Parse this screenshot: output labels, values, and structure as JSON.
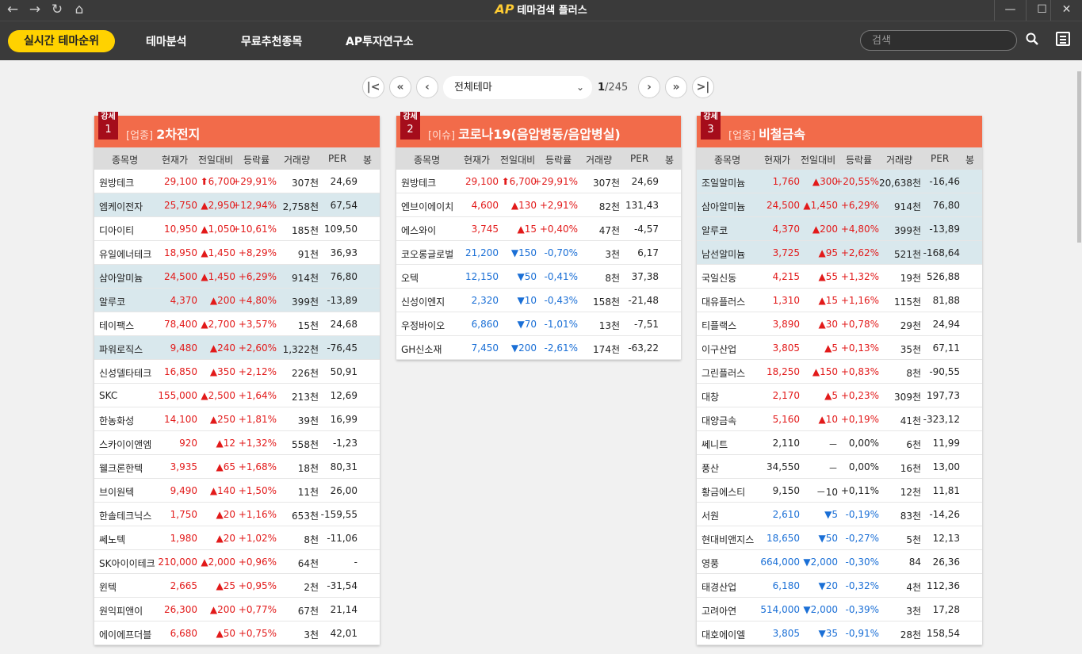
{
  "app": {
    "title": "테마검색 플러스",
    "logo": "AP"
  },
  "nav_icons": [
    "back-icon",
    "forward-icon",
    "refresh-icon",
    "home-icon"
  ],
  "window_controls": [
    "minimize-icon",
    "maximize-icon",
    "close-icon"
  ],
  "menu": {
    "active": "실시간 테마순위",
    "items": [
      "테마분석",
      "무료추천종목",
      "AP투자연구소"
    ],
    "search_placeholder": "검색"
  },
  "pager": {
    "select": "전체테마",
    "current": "1",
    "total": "/245"
  },
  "columns": [
    "종목명",
    "현재가",
    "전일대비",
    "등락률",
    "거래량",
    "PER",
    "봉"
  ],
  "colors": {
    "up": "#e21a1a",
    "down": "#1a6fd6",
    "header": "#f26b4a",
    "badge": "#a50d1b",
    "highlight": "#d9e8ed"
  },
  "panels": [
    {
      "strength": "강세",
      "rank": "1",
      "category": "[업종]",
      "name": "2차전지",
      "rows": [
        {
          "name": "원방테크",
          "price": "29,100",
          "chg": "⬆6,700",
          "rate": "+29,91%",
          "vol": "307천",
          "per": "24,69",
          "dir": "up",
          "hl": false,
          "candle": {
            "top": 0.2,
            "bot": 0.8,
            "btop": 0.2,
            "bbot": 0.7
          }
        },
        {
          "name": "엠케이전자",
          "price": "25,750",
          "chg": "▲2,950",
          "rate": "+12,94%",
          "vol": "2,758천",
          "per": "67,54",
          "dir": "up",
          "hl": true,
          "candle": {
            "top": 0.15,
            "bot": 0.85,
            "btop": 0.2,
            "bbot": 0.8
          }
        },
        {
          "name": "디아이티",
          "price": "10,950",
          "chg": "▲1,050",
          "rate": "+10,61%",
          "vol": "185천",
          "per": "109,50",
          "dir": "up",
          "hl": false,
          "candle": {
            "top": 0.2,
            "bot": 0.8,
            "btop": 0.25,
            "bbot": 0.8
          }
        },
        {
          "name": "유일에너테크",
          "price": "18,950",
          "chg": "▲1,450",
          "rate": "+8,29%",
          "vol": "91천",
          "per": "36,93",
          "dir": "up",
          "hl": false,
          "candle": {
            "top": 0.15,
            "bot": 0.85,
            "btop": 0.2,
            "bbot": 0.8
          }
        },
        {
          "name": "삼아알미늄",
          "price": "24,500",
          "chg": "▲1,450",
          "rate": "+6,29%",
          "vol": "914천",
          "per": "76,80",
          "dir": "up",
          "hl": true,
          "candle": {
            "top": 0.2,
            "bot": 0.8,
            "btop": 0.25,
            "bbot": 0.75
          }
        },
        {
          "name": "알루코",
          "price": "4,370",
          "chg": "▲200",
          "rate": "+4,80%",
          "vol": "399천",
          "per": "-13,89",
          "dir": "up",
          "hl": true,
          "candle": {
            "top": 0.2,
            "bot": 0.8,
            "btop": 0.25,
            "bbot": 0.7
          }
        },
        {
          "name": "테이팩스",
          "price": "78,400",
          "chg": "▲2,700",
          "rate": "+3,57%",
          "vol": "15천",
          "per": "24,68",
          "dir": "up",
          "hl": false,
          "candle": {
            "top": 0.2,
            "bot": 0.8,
            "btop": 0.25,
            "bbot": 0.7
          }
        },
        {
          "name": "파워로직스",
          "price": "9,480",
          "chg": "▲240",
          "rate": "+2,60%",
          "vol": "1,322천",
          "per": "-76,45",
          "dir": "up",
          "hl": true,
          "candle": {
            "top": 0.2,
            "bot": 0.8,
            "btop": 0.3,
            "bbot": 0.7
          }
        },
        {
          "name": "신성델타테크",
          "price": "16,850",
          "chg": "▲350",
          "rate": "+2,12%",
          "vol": "226천",
          "per": "50,91",
          "dir": "up",
          "hl": false,
          "candle": {
            "top": 0.3,
            "bot": 0.8,
            "btop": 0.45,
            "bbot": 0.65
          }
        },
        {
          "name": "SKC",
          "price": "155,000",
          "chg": "▲2,500",
          "rate": "+1,64%",
          "vol": "213천",
          "per": "12,69",
          "dir": "up",
          "hl": false,
          "candle": {
            "top": 0.3,
            "bot": 0.8,
            "btop": 0.45,
            "bbot": 0.7
          },
          "cdn": true
        },
        {
          "name": "한농화성",
          "price": "14,100",
          "chg": "▲250",
          "rate": "+1,81%",
          "vol": "39천",
          "per": "16,99",
          "dir": "up",
          "hl": false,
          "candle": {
            "top": 0.25,
            "bot": 0.8,
            "btop": 0.45,
            "bbot": 0.55
          }
        },
        {
          "name": "스카이이앤엠",
          "price": "920",
          "chg": "▲12",
          "rate": "+1,32%",
          "vol": "558천",
          "per": "-1,23",
          "dir": "up",
          "hl": false,
          "candle": {
            "top": 0.2,
            "bot": 0.8,
            "btop": 0.55,
            "bbot": 0.75
          },
          "cdn": true
        },
        {
          "name": "웰크론한텍",
          "price": "3,935",
          "chg": "▲65",
          "rate": "+1,68%",
          "vol": "18천",
          "per": "80,31",
          "dir": "up",
          "hl": false,
          "candle": {
            "top": 0.2,
            "bot": 0.8,
            "btop": 0.35,
            "bbot": 0.65
          }
        },
        {
          "name": "브이원텍",
          "price": "9,490",
          "chg": "▲140",
          "rate": "+1,50%",
          "vol": "11천",
          "per": "26,00",
          "dir": "up",
          "hl": false,
          "candle": {
            "top": 0.2,
            "bot": 0.8,
            "btop": 0.35,
            "bbot": 0.65
          }
        },
        {
          "name": "한솔테크닉스",
          "price": "1,750",
          "chg": "▲20",
          "rate": "+1,16%",
          "vol": "653천",
          "per": "-159,55",
          "dir": "up",
          "hl": false,
          "candle": {
            "top": 0.2,
            "bot": 0.8,
            "btop": 0.45,
            "bbot": 0.7
          },
          "cdn": true
        },
        {
          "name": "쎄노텍",
          "price": "1,980",
          "chg": "▲20",
          "rate": "+1,02%",
          "vol": "8천",
          "per": "-11,06",
          "dir": "up",
          "hl": false,
          "candle": {
            "top": 0.2,
            "bot": 0.8,
            "btop": 0.35,
            "bbot": 0.7
          }
        },
        {
          "name": "SK아이이테크",
          "price": "210,000",
          "chg": "▲2,000",
          "rate": "+0,96%",
          "vol": "64천",
          "per": "-",
          "dir": "up",
          "hl": false,
          "candle": {
            "top": 0.2,
            "bot": 0.8,
            "btop": 0.3,
            "bbot": 0.7
          }
        },
        {
          "name": "윈텍",
          "price": "2,665",
          "chg": "▲25",
          "rate": "+0,95%",
          "vol": "2천",
          "per": "-31,54",
          "dir": "up",
          "hl": false,
          "candle": {
            "top": 0.2,
            "bot": 0.8,
            "btop": 0.2,
            "bbot": 0.55
          },
          "cdn": true
        },
        {
          "name": "원익피앤이",
          "price": "26,300",
          "chg": "▲200",
          "rate": "+0,77%",
          "vol": "67천",
          "per": "21,14",
          "dir": "up",
          "hl": false,
          "candle": {
            "top": 0.2,
            "bot": 0.8,
            "btop": 0.3,
            "bbot": 0.7
          },
          "cdn": true
        },
        {
          "name": "에이에프더블",
          "price": "6,680",
          "chg": "▲50",
          "rate": "+0,75%",
          "vol": "3천",
          "per": "42,01",
          "dir": "up",
          "hl": false,
          "candle": {
            "top": 0.2,
            "bot": 0.8,
            "btop": 0.55,
            "bbot": 0.65
          }
        }
      ]
    },
    {
      "strength": "강세",
      "rank": "2",
      "category": "[이슈]",
      "name": "코로나19(음압병동/음압병실)",
      "rows": [
        {
          "name": "원방테크",
          "price": "29,100",
          "chg": "⬆6,700",
          "rate": "+29,91%",
          "vol": "307천",
          "per": "24,69",
          "dir": "up",
          "hl": false,
          "candle": {
            "top": 0.2,
            "bot": 0.8,
            "btop": 0.2,
            "bbot": 0.7
          }
        },
        {
          "name": "엔브이에이치",
          "price": "4,600",
          "chg": "▲130",
          "rate": "+2,91%",
          "vol": "82천",
          "per": "131,43",
          "dir": "up",
          "hl": false,
          "candle": {
            "top": 0.15,
            "bot": 0.85,
            "btop": 0.25,
            "bbot": 0.8
          }
        },
        {
          "name": "에스와이",
          "price": "3,745",
          "chg": "▲15",
          "rate": "+0,40%",
          "vol": "47천",
          "per": "-4,57",
          "dir": "up",
          "hl": false,
          "candle": {
            "top": 0.2,
            "bot": 0.8,
            "btop": 0.35,
            "bbot": 0.65
          }
        },
        {
          "name": "코오롱글로벌",
          "price": "21,200",
          "chg": "▼150",
          "rate": "-0,70%",
          "vol": "3천",
          "per": "6,17",
          "dir": "dn",
          "hl": false,
          "candle": {
            "top": 0.3,
            "bot": 0.85,
            "btop": 0.35,
            "bbot": 0.8
          }
        },
        {
          "name": "오텍",
          "price": "12,150",
          "chg": "▼50",
          "rate": "-0,41%",
          "vol": "8천",
          "per": "37,38",
          "dir": "dn",
          "hl": false,
          "candle": {
            "top": 0.15,
            "bot": 0.85,
            "btop": 0.5,
            "bbot": 0.52
          },
          "gray": true
        },
        {
          "name": "신성이엔지",
          "price": "2,320",
          "chg": "▼10",
          "rate": "-0,43%",
          "vol": "158천",
          "per": "-21,48",
          "dir": "dn",
          "hl": false,
          "candle": {
            "top": 0.15,
            "bot": 0.85,
            "btop": 0.5,
            "bbot": 0.52
          },
          "gray": true
        },
        {
          "name": "우정바이오",
          "price": "6,860",
          "chg": "▼70",
          "rate": "-1,01%",
          "vol": "13천",
          "per": "-7,51",
          "dir": "dn",
          "hl": false,
          "candle": {
            "top": 0.2,
            "bot": 0.8,
            "btop": 0.35,
            "bbot": 0.7
          },
          "cup": true
        },
        {
          "name": "GH신소재",
          "price": "7,450",
          "chg": "▼200",
          "rate": "-2,61%",
          "vol": "174천",
          "per": "-63,22",
          "dir": "dn",
          "hl": false,
          "candle": {
            "top": 0.15,
            "bot": 0.85,
            "btop": 0.3,
            "bbot": 0.8
          }
        }
      ]
    },
    {
      "strength": "강세",
      "rank": "3",
      "category": "[업종]",
      "name": "비철금속",
      "rows": [
        {
          "name": "조일알미늄",
          "price": "1,760",
          "chg": "▲300",
          "rate": "+20,55%",
          "vol": "20,638천",
          "per": "-16,46",
          "dir": "up",
          "hl": true,
          "candle": {
            "top": 0.2,
            "bot": 0.8,
            "btop": 0.2,
            "bbot": 0.75
          }
        },
        {
          "name": "삼아알미늄",
          "price": "24,500",
          "chg": "▲1,450",
          "rate": "+6,29%",
          "vol": "914천",
          "per": "76,80",
          "dir": "up",
          "hl": true,
          "candle": {
            "top": 0.2,
            "bot": 0.8,
            "btop": 0.25,
            "bbot": 0.75
          }
        },
        {
          "name": "알루코",
          "price": "4,370",
          "chg": "▲200",
          "rate": "+4,80%",
          "vol": "399천",
          "per": "-13,89",
          "dir": "up",
          "hl": true,
          "candle": {
            "top": 0.2,
            "bot": 0.8,
            "btop": 0.25,
            "bbot": 0.7
          }
        },
        {
          "name": "남선알미늄",
          "price": "3,725",
          "chg": "▲95",
          "rate": "+2,62%",
          "vol": "521천",
          "per": "-168,64",
          "dir": "up",
          "hl": true,
          "candle": {
            "top": 0.2,
            "bot": 0.8,
            "btop": 0.25,
            "bbot": 0.75
          }
        },
        {
          "name": "국일신동",
          "price": "4,215",
          "chg": "▲55",
          "rate": "+1,32%",
          "vol": "19천",
          "per": "526,88",
          "dir": "up",
          "hl": false,
          "candle": {
            "top": 0.2,
            "bot": 0.8,
            "btop": 0.3,
            "bbot": 0.75
          }
        },
        {
          "name": "대유플러스",
          "price": "1,310",
          "chg": "▲15",
          "rate": "+1,16%",
          "vol": "115천",
          "per": "81,88",
          "dir": "up",
          "hl": false,
          "candle": {
            "top": 0.2,
            "bot": 0.8,
            "btop": 0.4,
            "bbot": 0.75
          }
        },
        {
          "name": "티플랙스",
          "price": "3,890",
          "chg": "▲30",
          "rate": "+0,78%",
          "vol": "29천",
          "per": "24,94",
          "dir": "up",
          "hl": false,
          "candle": {
            "top": 0.2,
            "bot": 0.8,
            "btop": 0.2,
            "bbot": 0.75
          }
        },
        {
          "name": "이구산업",
          "price": "3,805",
          "chg": "▲5",
          "rate": "+0,13%",
          "vol": "35천",
          "per": "67,11",
          "dir": "up",
          "hl": false,
          "candle": {
            "top": 0.15,
            "bot": 0.85,
            "btop": 0.5,
            "bbot": 0.52
          },
          "gray": true
        },
        {
          "name": "그린플러스",
          "price": "18,250",
          "chg": "▲150",
          "rate": "+0,83%",
          "vol": "8천",
          "per": "-90,55",
          "dir": "up",
          "hl": false,
          "candle": {
            "top": 0.3,
            "bot": 0.75,
            "btop": 0.45,
            "bbot": 0.58
          }
        },
        {
          "name": "대창",
          "price": "2,170",
          "chg": "▲5",
          "rate": "+0,23%",
          "vol": "309천",
          "per": "197,73",
          "dir": "up",
          "hl": false,
          "candle": {
            "top": 0.25,
            "bot": 0.8,
            "btop": 0.35,
            "bbot": 0.8
          },
          "cdn": true
        },
        {
          "name": "대양금속",
          "price": "5,160",
          "chg": "▲10",
          "rate": "+0,19%",
          "vol": "41천",
          "per": "-323,12",
          "dir": "up",
          "hl": false,
          "candle": {
            "top": 0.2,
            "bot": 0.8,
            "btop": 0.2,
            "bbot": 0.8
          },
          "cdn": true
        },
        {
          "name": "쎄니트",
          "price": "2,110",
          "chg": "－",
          "rate": "0,00%",
          "vol": "6천",
          "per": "11,99",
          "dir": "flat",
          "hl": false,
          "candle": {
            "top": 0.15,
            "bot": 0.85,
            "btop": 0.5,
            "bbot": 0.52
          },
          "gray": true
        },
        {
          "name": "풍산",
          "price": "34,550",
          "chg": "－",
          "rate": "0,00%",
          "vol": "16천",
          "per": "13,00",
          "dir": "flat",
          "hl": false,
          "candle": {
            "top": 0.15,
            "bot": 0.85,
            "btop": 0.5,
            "bbot": 0.52
          },
          "gray": true
        },
        {
          "name": "황금에스티",
          "price": "9,150",
          "chg": "－10",
          "rate": "+0,11%",
          "vol": "12천",
          "per": "11,81",
          "dir": "flat",
          "hl": false,
          "candle": {
            "top": 0.2,
            "bot": 0.85,
            "btop": 0.5,
            "bbot": 0.55
          }
        },
        {
          "name": "서원",
          "price": "2,610",
          "chg": "▼5",
          "rate": "-0,19%",
          "vol": "83천",
          "per": "-14,26",
          "dir": "dn",
          "hl": false,
          "candle": {
            "top": 0.15,
            "bot": 0.85,
            "btop": 0.5,
            "bbot": 0.55
          }
        },
        {
          "name": "현대비앤지스",
          "price": "18,650",
          "chg": "▼50",
          "rate": "-0,27%",
          "vol": "5천",
          "per": "12,13",
          "dir": "dn",
          "hl": false,
          "candle": {
            "top": 0.2,
            "bot": 0.8,
            "btop": 0.2,
            "bbot": 0.8
          }
        },
        {
          "name": "영풍",
          "price": "664,000",
          "chg": "▼2,000",
          "rate": "-0,30%",
          "vol": "84",
          "per": "26,36",
          "dir": "dn",
          "hl": false,
          "candle": {
            "top": 0.2,
            "bot": 0.8,
            "btop": 0.45,
            "bbot": 0.7
          }
        },
        {
          "name": "태경산업",
          "price": "6,180",
          "chg": "▼20",
          "rate": "-0,32%",
          "vol": "4천",
          "per": "112,36",
          "dir": "dn",
          "hl": false,
          "candle": {
            "top": 0.2,
            "bot": 0.8,
            "btop": 0.4,
            "bbot": 0.65
          }
        },
        {
          "name": "고려아연",
          "price": "514,000",
          "chg": "▼2,000",
          "rate": "-0,39%",
          "vol": "3천",
          "per": "17,28",
          "dir": "dn",
          "hl": false,
          "candle": {
            "top": 0.2,
            "bot": 0.8,
            "btop": 0.2,
            "bbot": 0.8
          },
          "cup": true
        },
        {
          "name": "대호에이엘",
          "price": "3,805",
          "chg": "▼35",
          "rate": "-0,91%",
          "vol": "28천",
          "per": "158,54",
          "dir": "dn",
          "hl": false,
          "candle": {
            "top": 0.2,
            "bot": 0.8,
            "btop": 0.35,
            "bbot": 0.75
          },
          "cup": true
        }
      ]
    }
  ]
}
